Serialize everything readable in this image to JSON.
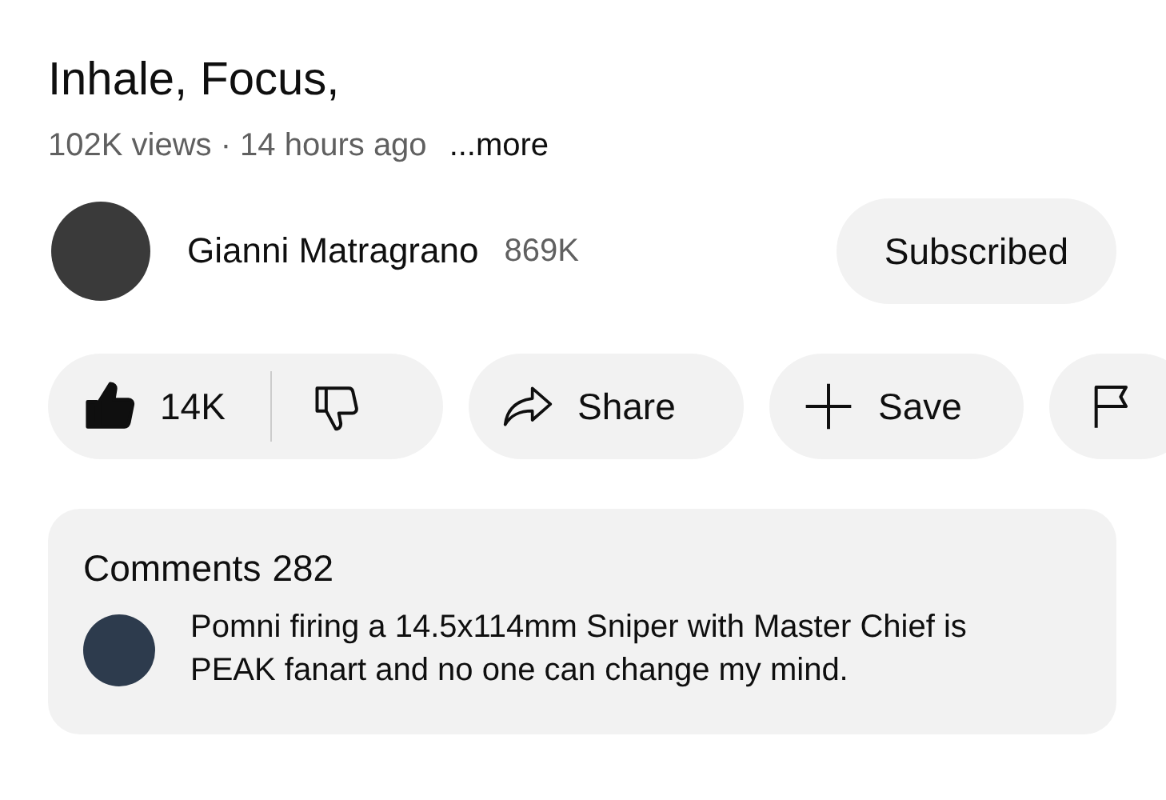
{
  "video": {
    "title": "Inhale, Focus,",
    "views": "102K views · 14 hours ago",
    "more": "...more"
  },
  "channel": {
    "name": "Gianni Matragrano",
    "subscribers": "869K",
    "subscribe_button": "Subscribed"
  },
  "actions": {
    "likes": "14K",
    "liked": true,
    "buttons": [
      {
        "kind": "share",
        "label": "Share"
      },
      {
        "kind": "save",
        "label": "Save"
      },
      {
        "kind": "report"
      }
    ]
  },
  "comments": {
    "label": "Comments",
    "count": "282",
    "top_comment": "Pomni firing a 14.5x114mm Sniper with Master Chief is PEAK fanart and no one can change my mind."
  }
}
